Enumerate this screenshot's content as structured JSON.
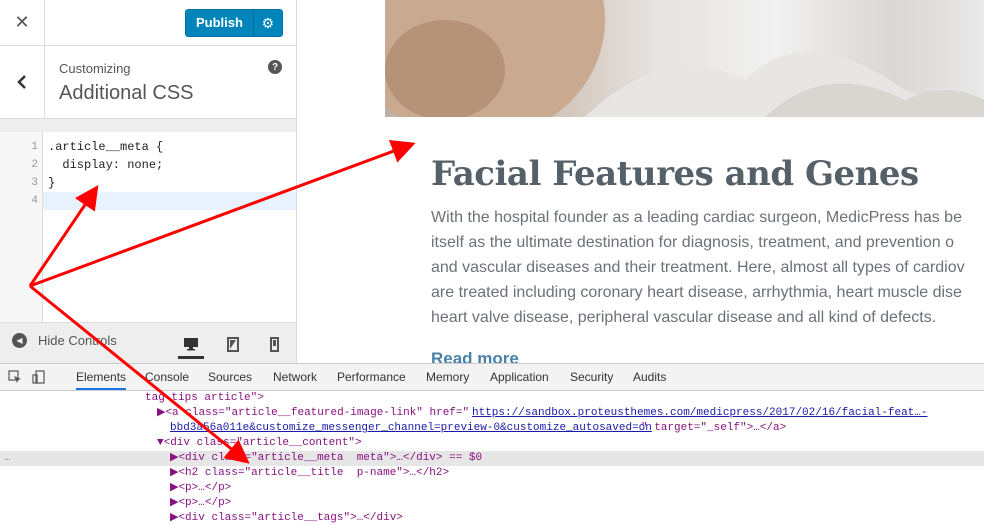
{
  "customizer": {
    "close_icon": "close-icon",
    "publish_label": "Publish",
    "publish_gear_icon": "gear-icon",
    "back_icon": "chevron-left-icon",
    "customizing_label": "Customizing",
    "section_title": "Additional CSS",
    "help_icon": "help-icon",
    "code_lines": [
      {
        "no": "1",
        "text": ".article__meta {"
      },
      {
        "no": "2",
        "text": "  display: none;"
      },
      {
        "no": "3",
        "text": "}"
      },
      {
        "no": "4",
        "text": ""
      }
    ],
    "hide_controls_label": "Hide Controls",
    "devices": [
      "desktop-icon",
      "tablet-icon",
      "mobile-icon"
    ]
  },
  "preview": {
    "post_title": "Facial Features and Genes",
    "body_lines": [
      "With the hospital founder as a leading cardiac surgeon, MedicPress has be",
      "itself as the ultimate destination for diagnosis, treatment, and prevention o",
      "and vascular diseases and their treatment. Here, almost all types of cardiov",
      "are treated including coronary heart disease, arrhythmia, heart muscle dise",
      "heart valve disease, peripheral vascular disease and all kind of defects."
    ],
    "read_more": "Read more"
  },
  "devtools": {
    "tabs": [
      "Elements",
      "Console",
      "Sources",
      "Network",
      "Performance",
      "Memory",
      "Application",
      "Security",
      "Audits"
    ],
    "dom": {
      "line0": "tag-tips article\">",
      "line1_prefix": "▶<a class=\"article__featured-image-link\" href=\"",
      "line1_href": "https://sandbox.proteusthemes.com/medicpress/2017/02/16/facial-feat…-",
      "line2_href": "bbd3a56a011e&customize_messenger_channel=preview-0&customize_autosaved=on",
      "line2_suffix": "\" target=\"_self\">…</a>",
      "line3": "▼<div class=\"article__content\">",
      "line4": "▶<div class=\"article__meta  meta\">…</div> == $0",
      "line5": "▶<h2 class=\"article__title  p-name\">…</h2>",
      "line6": "▶<p>…</p>",
      "line7": "▶<p>…</p>",
      "line8": "▶<div class=\"article__tags\">…</div>",
      "ellipsis": "…"
    }
  },
  "colors": {
    "publish": "#0085ba",
    "arrow": "#ff0000",
    "title": "#556068",
    "link": "#4a81a8"
  }
}
